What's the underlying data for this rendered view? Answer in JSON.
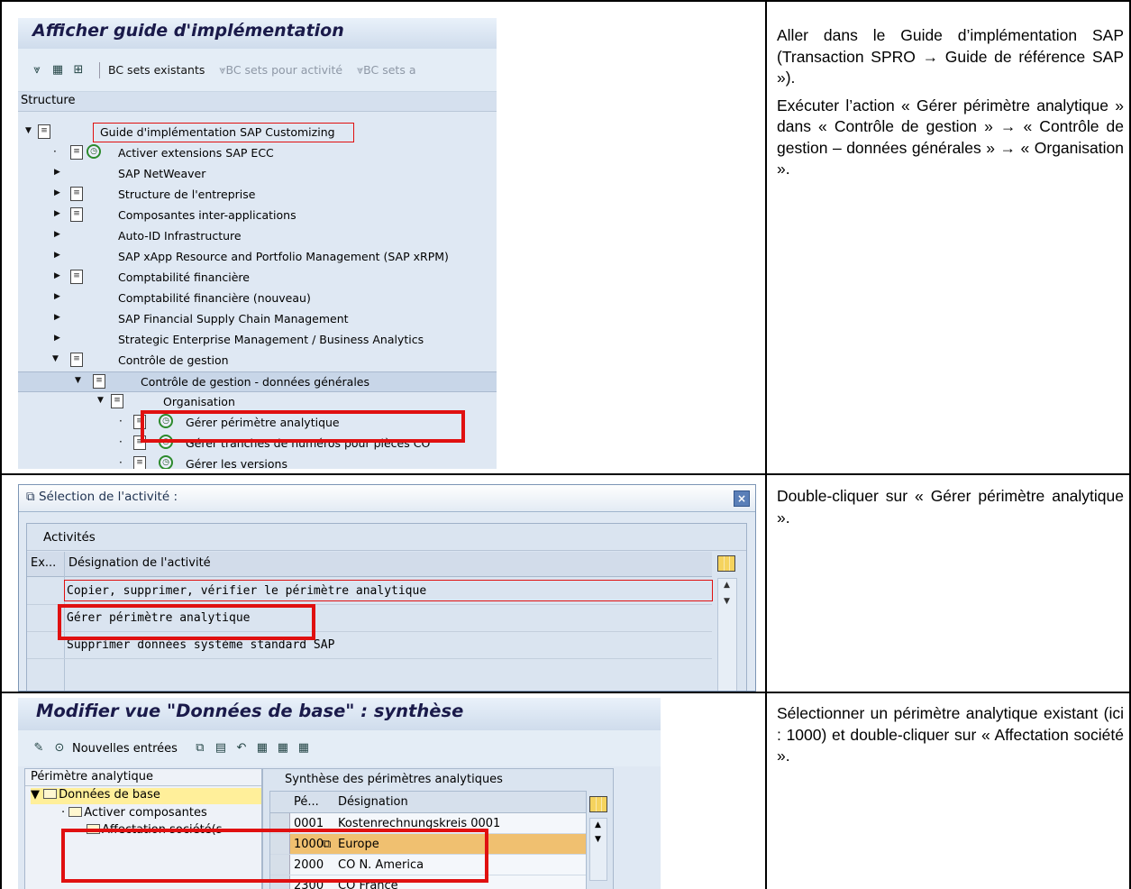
{
  "right_column": {
    "row1_p1": "Aller dans le Guide d’implémentation SAP (Transaction SPRO → Guide de référence SAP »).",
    "row1_p2": "Exécuter l’action « Gérer périmètre analytique » dans « Contrôle de gestion » → « Contrôle de gestion – données générales » → « Organisation ».",
    "row2_p1": "Double-cliquer sur « Gérer périmètre analytique ».",
    "row3_p1": "Sélectionner un périmètre analytique existant (ici : 1000) et double-cliquer sur « Affectation société »."
  },
  "screen1": {
    "title": "Afficher guide d'implémentation",
    "toolbar": {
      "bc_sets_existants": "BC sets existants",
      "bc_sets_activite": "BC sets pour activité",
      "bc_sets_a": "BC sets a"
    },
    "structure_label": "Structure",
    "tree": [
      "Guide d'implémentation SAP Customizing",
      "Activer extensions SAP ECC",
      "SAP NetWeaver",
      "Structure de l'entreprise",
      "Composantes inter-applications",
      "Auto-ID Infrastructure",
      "SAP xApp Resource and Portfolio Management (SAP xRPM)",
      "Comptabilité financière",
      "Comptabilité financière (nouveau)",
      "SAP Financial Supply Chain Management",
      "Strategic Enterprise Management / Business Analytics",
      "Contrôle de gestion",
      "Contrôle de gestion - données générales",
      "Organisation",
      "Gérer périmètre analytique",
      "Gérer tranches de numéros pour pièces CO",
      "Gérer les versions"
    ]
  },
  "screen2": {
    "title": "Sélection de l'activité :",
    "close": "×",
    "caption": "Activités",
    "col_ex": "Ex...",
    "col_designation": "Désignation de l'activité",
    "rows": [
      "Copier, supprimer, vérifier le périmètre analytique",
      "Gérer périmètre analytique",
      "Supprimer données système standard SAP"
    ]
  },
  "screen3": {
    "title": "Modifier vue \"Données de base\" : synthèse",
    "toolbar_new_entries": "Nouvelles entrées",
    "left_header": "Périmètre analytique",
    "left_items": [
      "Données de base",
      "Activer composantes",
      "Affectation société(s"
    ],
    "right_caption": "Synthèse des périmètres analytiques",
    "col_pe": "Pé...",
    "col_designation": "Désignation",
    "rows": [
      {
        "code": "0001",
        "name": "Kostenrechnungskreis 0001"
      },
      {
        "code": "1000",
        "name": "Europe"
      },
      {
        "code": "2000",
        "name": "CO N. America"
      },
      {
        "code": "2300",
        "name": "CO France"
      }
    ]
  }
}
